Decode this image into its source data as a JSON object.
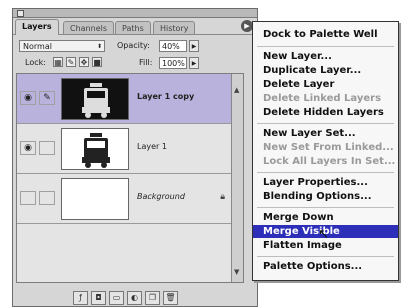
{
  "tabs": [
    "Layers",
    "Channels",
    "Paths",
    "History"
  ],
  "blend_mode": "Normal",
  "opacity": {
    "label": "Opacity:",
    "value": "40%"
  },
  "lock": {
    "label": "Lock:"
  },
  "fill": {
    "label": "Fill:",
    "value": "100%"
  },
  "layers": [
    {
      "name": "Layer 1 copy"
    },
    {
      "name": "Layer 1"
    },
    {
      "name": "Background"
    }
  ],
  "menu": {
    "items": [
      {
        "label": "Dock to Palette Well"
      },
      {
        "label": "New Layer..."
      },
      {
        "label": "Duplicate Layer..."
      },
      {
        "label": "Delete Layer"
      },
      {
        "label": "Delete Linked Layers"
      },
      {
        "label": "Delete Hidden Layers"
      },
      {
        "label": "New Layer Set..."
      },
      {
        "label": "New Set From Linked..."
      },
      {
        "label": "Lock All Layers In Set..."
      },
      {
        "label": "Layer Properties..."
      },
      {
        "label": "Blending Options..."
      },
      {
        "label": "Merge Down"
      },
      {
        "label": "Merge Visible"
      },
      {
        "label": "Flatten Image"
      },
      {
        "label": "Palette Options..."
      }
    ]
  },
  "colors": {
    "selection": "#2d2fb8",
    "selected_layer": "#b9b2dd"
  }
}
